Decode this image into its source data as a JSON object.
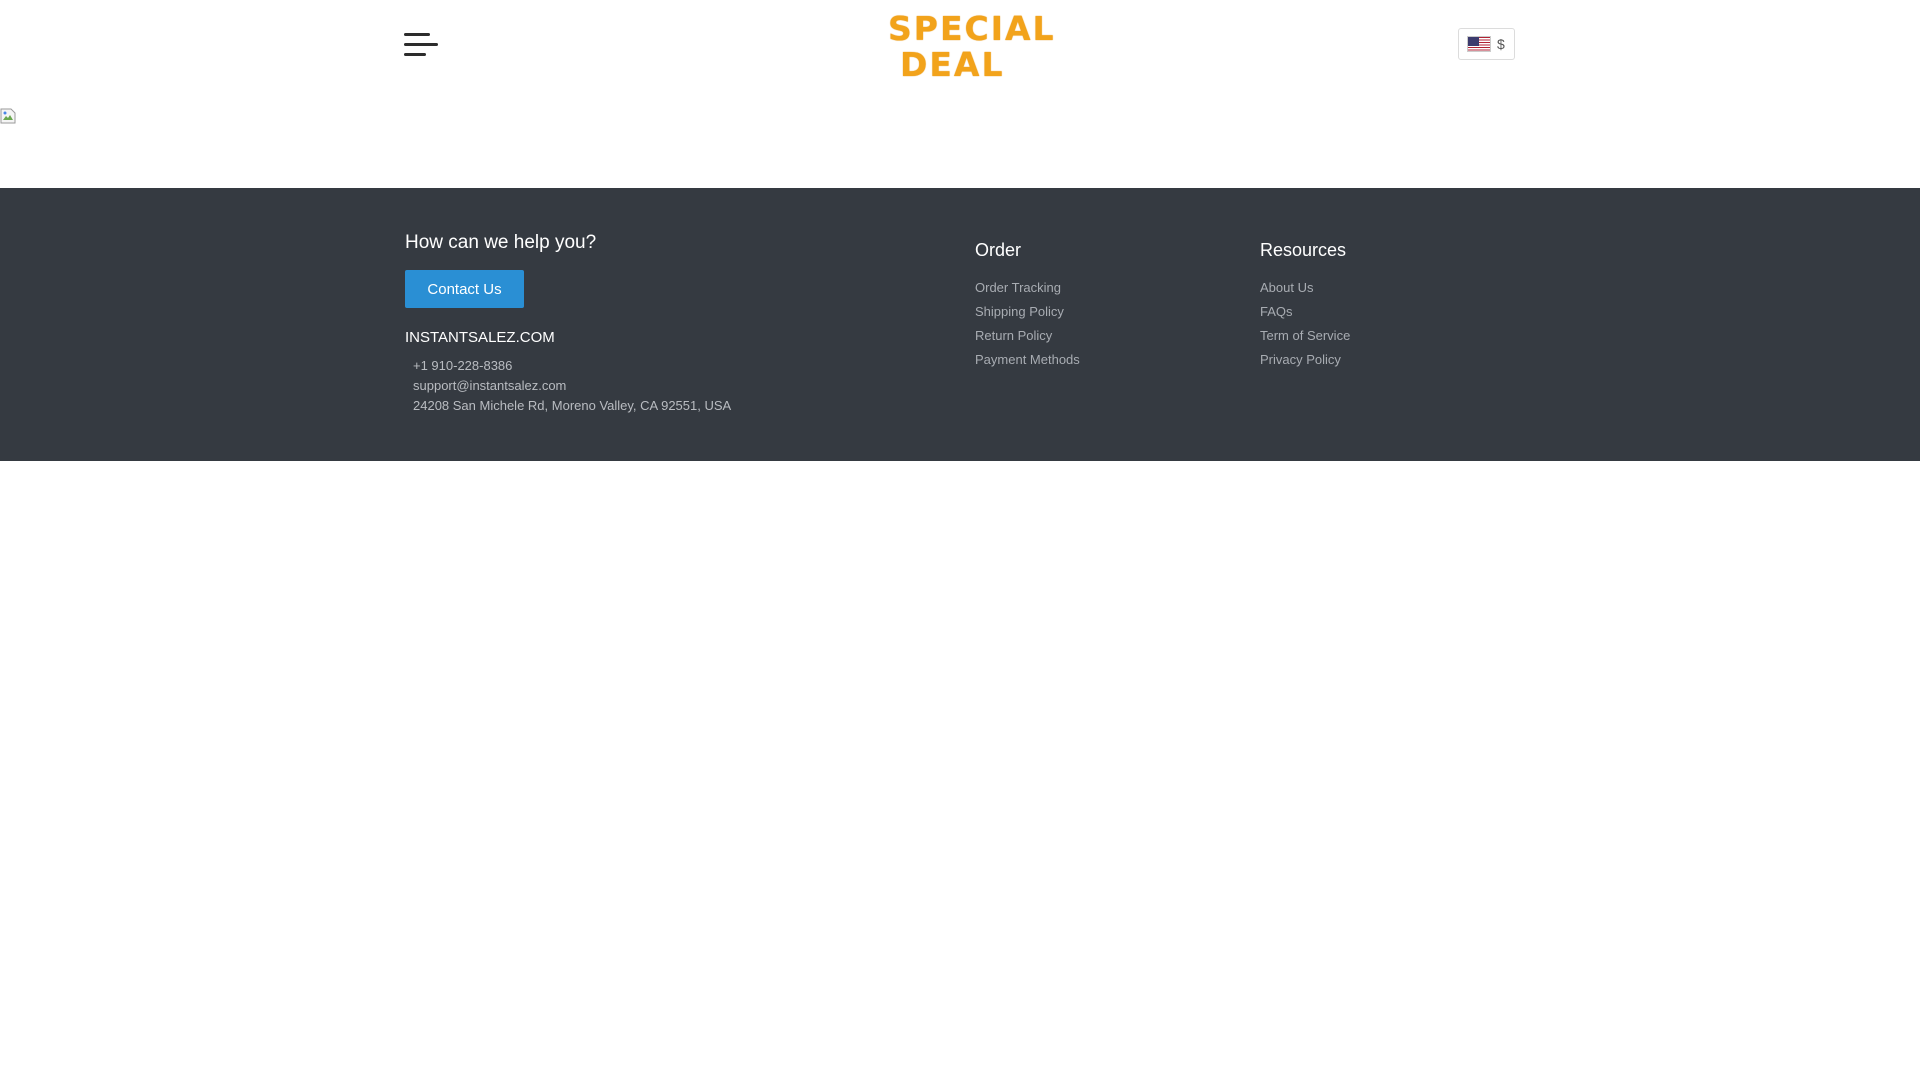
{
  "header": {
    "logo": {
      "line1": "SPECIAL",
      "line2": "DEAL"
    },
    "currency": {
      "symbol": "$",
      "flag_icon": "us-flag-icon"
    },
    "menu_icon": "hamburger-menu-icon"
  },
  "footer": {
    "help_title": "How can we help you?",
    "contact_button": "Contact Us",
    "brand": "INSTANTSALEZ.COM",
    "phone": "+1 910-228-8386",
    "email": "support@instantsalez.com",
    "address": "24208 San Michele Rd, Moreno Valley, CA 92551, USA",
    "order": {
      "title": "Order",
      "links": [
        "Order Tracking",
        "Shipping Policy",
        "Return Policy",
        "Payment Methods"
      ]
    },
    "resources": {
      "title": "Resources",
      "links": [
        "About Us",
        "FAQs",
        "Term of Service",
        "Privacy Policy"
      ]
    }
  },
  "colors": {
    "footer_bg": "#353a41",
    "button_bg": "#2a8fd4",
    "logo": "#f2a31b"
  }
}
